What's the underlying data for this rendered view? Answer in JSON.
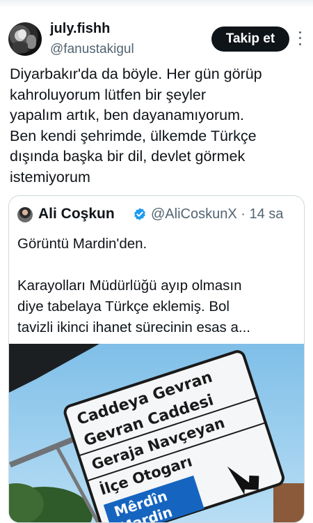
{
  "tweet": {
    "author_name": "july.fishh",
    "author_handle": "@fanustakigul",
    "follow_label": "Takip et",
    "text_lines": [
      "Diyarbakır'da da böyle. Her gün görüp",
      "kahroluyorum lütfen bir şeyler",
      "yapalım artık, ben dayanamıyorum.",
      "Ben kendi şehrimde, ülkemde Türkçe",
      "dışında başka bir dil, devlet görmek",
      "istemiyorum"
    ]
  },
  "quote": {
    "author_name": "Ali Coşkun",
    "author_handle": "@AliCoskunX · 14 sa",
    "text_lines": [
      "Görüntü Mardin'den.",
      "",
      "Karayolları Müdürlüğü ayıp olmasın",
      "diye tabelaya Türkçe eklemiş. Bol",
      "tavizli ikinci ihanet sürecinin esas a..."
    ],
    "sign_lines": [
      "Caddeya Gevran",
      "Gevran Caddesi",
      "Geraja Navçeyan",
      "İlçe Otogarı",
      "Mêrdîn",
      "Mardin"
    ]
  },
  "colors": {
    "follow_bg": "#0f1419",
    "verified": "#1d9bf0",
    "muted_text": "#536471",
    "sign_blue": "#1565c0",
    "sky": "#8fc9ee"
  },
  "icons": {
    "more": "more-vertical-icon",
    "verified": "verified-badge-icon",
    "arrow": "arrow-down-right-icon"
  }
}
